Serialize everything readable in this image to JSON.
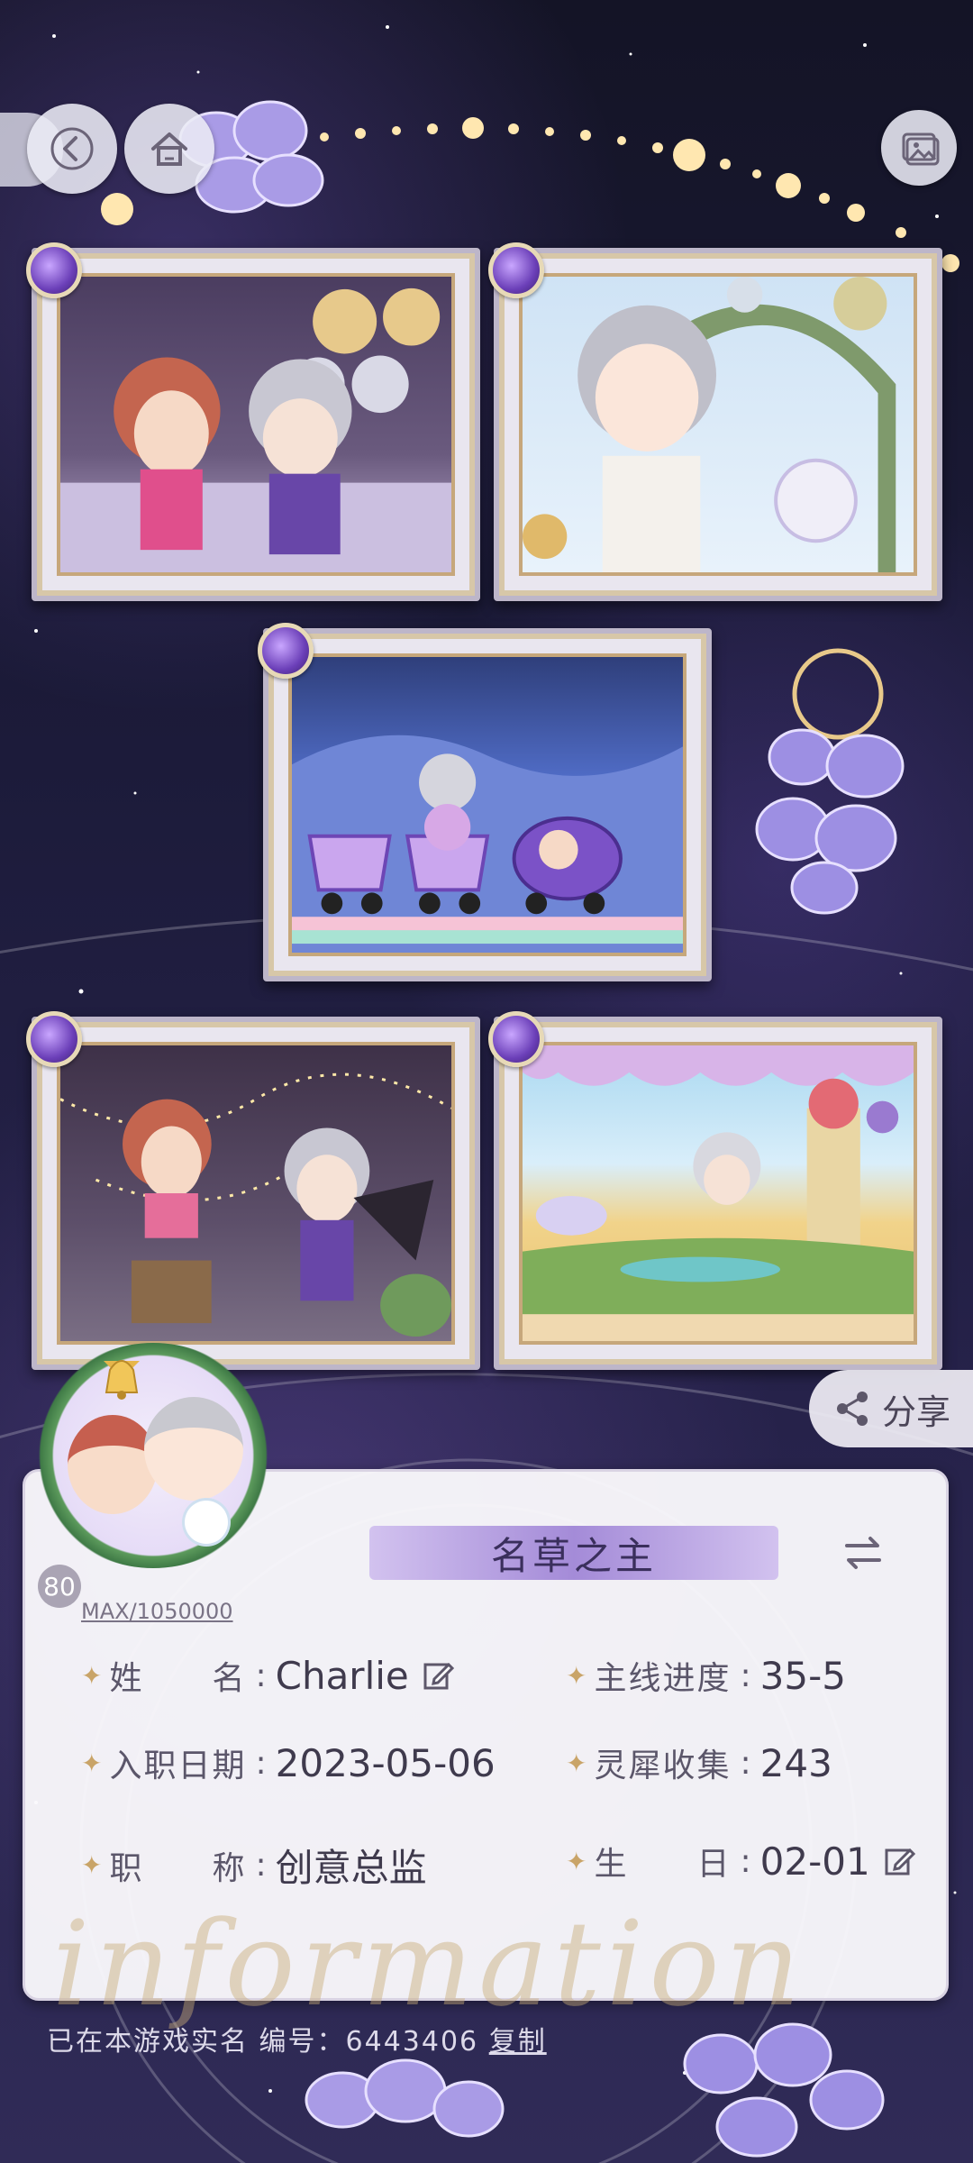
{
  "top_bar": {
    "back_icon": "chevron-left-icon",
    "home_icon": "home-icon",
    "gallery_icon": "image-gallery-icon"
  },
  "share": {
    "label": "分享",
    "icon": "share-icon"
  },
  "info_card": {
    "title": "名草之主",
    "switch_icon": "swap-arrows-icon",
    "rows": [
      {
        "label": "姓　　名",
        "value": "Charlie",
        "editable": true
      },
      {
        "label": "主线进度",
        "value": "35-5",
        "editable": false
      },
      {
        "label": "入职日期",
        "value": "2023-05-06",
        "editable": false
      },
      {
        "label": "灵犀收集",
        "value": "243",
        "editable": false
      },
      {
        "label": "职　　称",
        "value": "创意总监",
        "editable": false
      },
      {
        "label": "生　　日",
        "value": "02-01",
        "editable": true
      }
    ],
    "colon": ":",
    "watermark": "information"
  },
  "avatar": {
    "level": "80",
    "max_text": "MAX/1050000"
  },
  "footer": {
    "verified_text": "已在本游戏实名  编号：6443406",
    "link_text": "复制"
  },
  "colors": {
    "accent_purple": "#a48bd8",
    "gold": "#c9a468",
    "card_bg": "#faf9fc"
  }
}
